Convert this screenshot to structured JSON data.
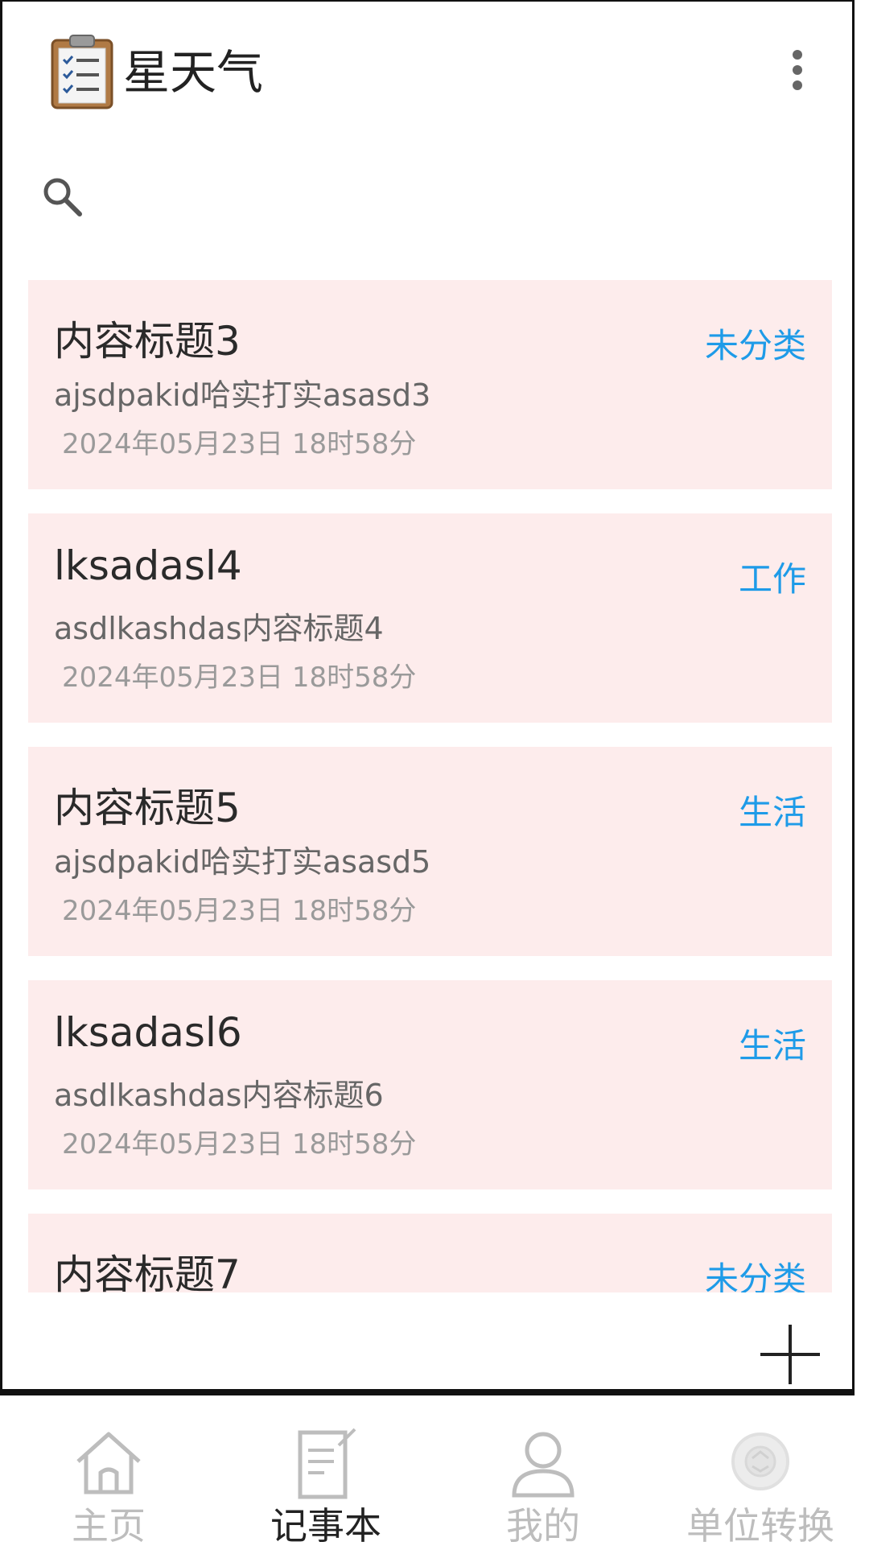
{
  "app": {
    "title": "星天气"
  },
  "search": {
    "placeholder": ""
  },
  "notes": [
    {
      "title": "内容标题3",
      "content": "ajsdpakid哈实打实asasd3",
      "time": "2024年05月23日 18时58分",
      "category": "未分类"
    },
    {
      "title": "lksadasl4",
      "content": "asdlkashdas内容标题4",
      "time": "2024年05月23日 18时58分",
      "category": "工作"
    },
    {
      "title": "内容标题5",
      "content": "ajsdpakid哈实打实asasd5",
      "time": "2024年05月23日 18时58分",
      "category": "生活"
    },
    {
      "title": "lksadasl6",
      "content": "asdlkashdas内容标题6",
      "time": "2024年05月23日 18时58分",
      "category": "生活"
    },
    {
      "title": "内容标题7",
      "content": "",
      "time": "",
      "category": "未分类"
    }
  ],
  "bottom_nav": {
    "items": [
      {
        "label": "主页",
        "icon": "home-icon"
      },
      {
        "label": "记事本",
        "icon": "notepad-icon"
      },
      {
        "label": "我的",
        "icon": "user-icon"
      },
      {
        "label": "单位转换",
        "icon": "convert-icon"
      }
    ],
    "active_index": 1
  },
  "colors": {
    "card_background": "#fdecec",
    "category_text": "#1e9be8",
    "inactive_nav": "#bdbdbd",
    "active_nav": "#222222"
  }
}
